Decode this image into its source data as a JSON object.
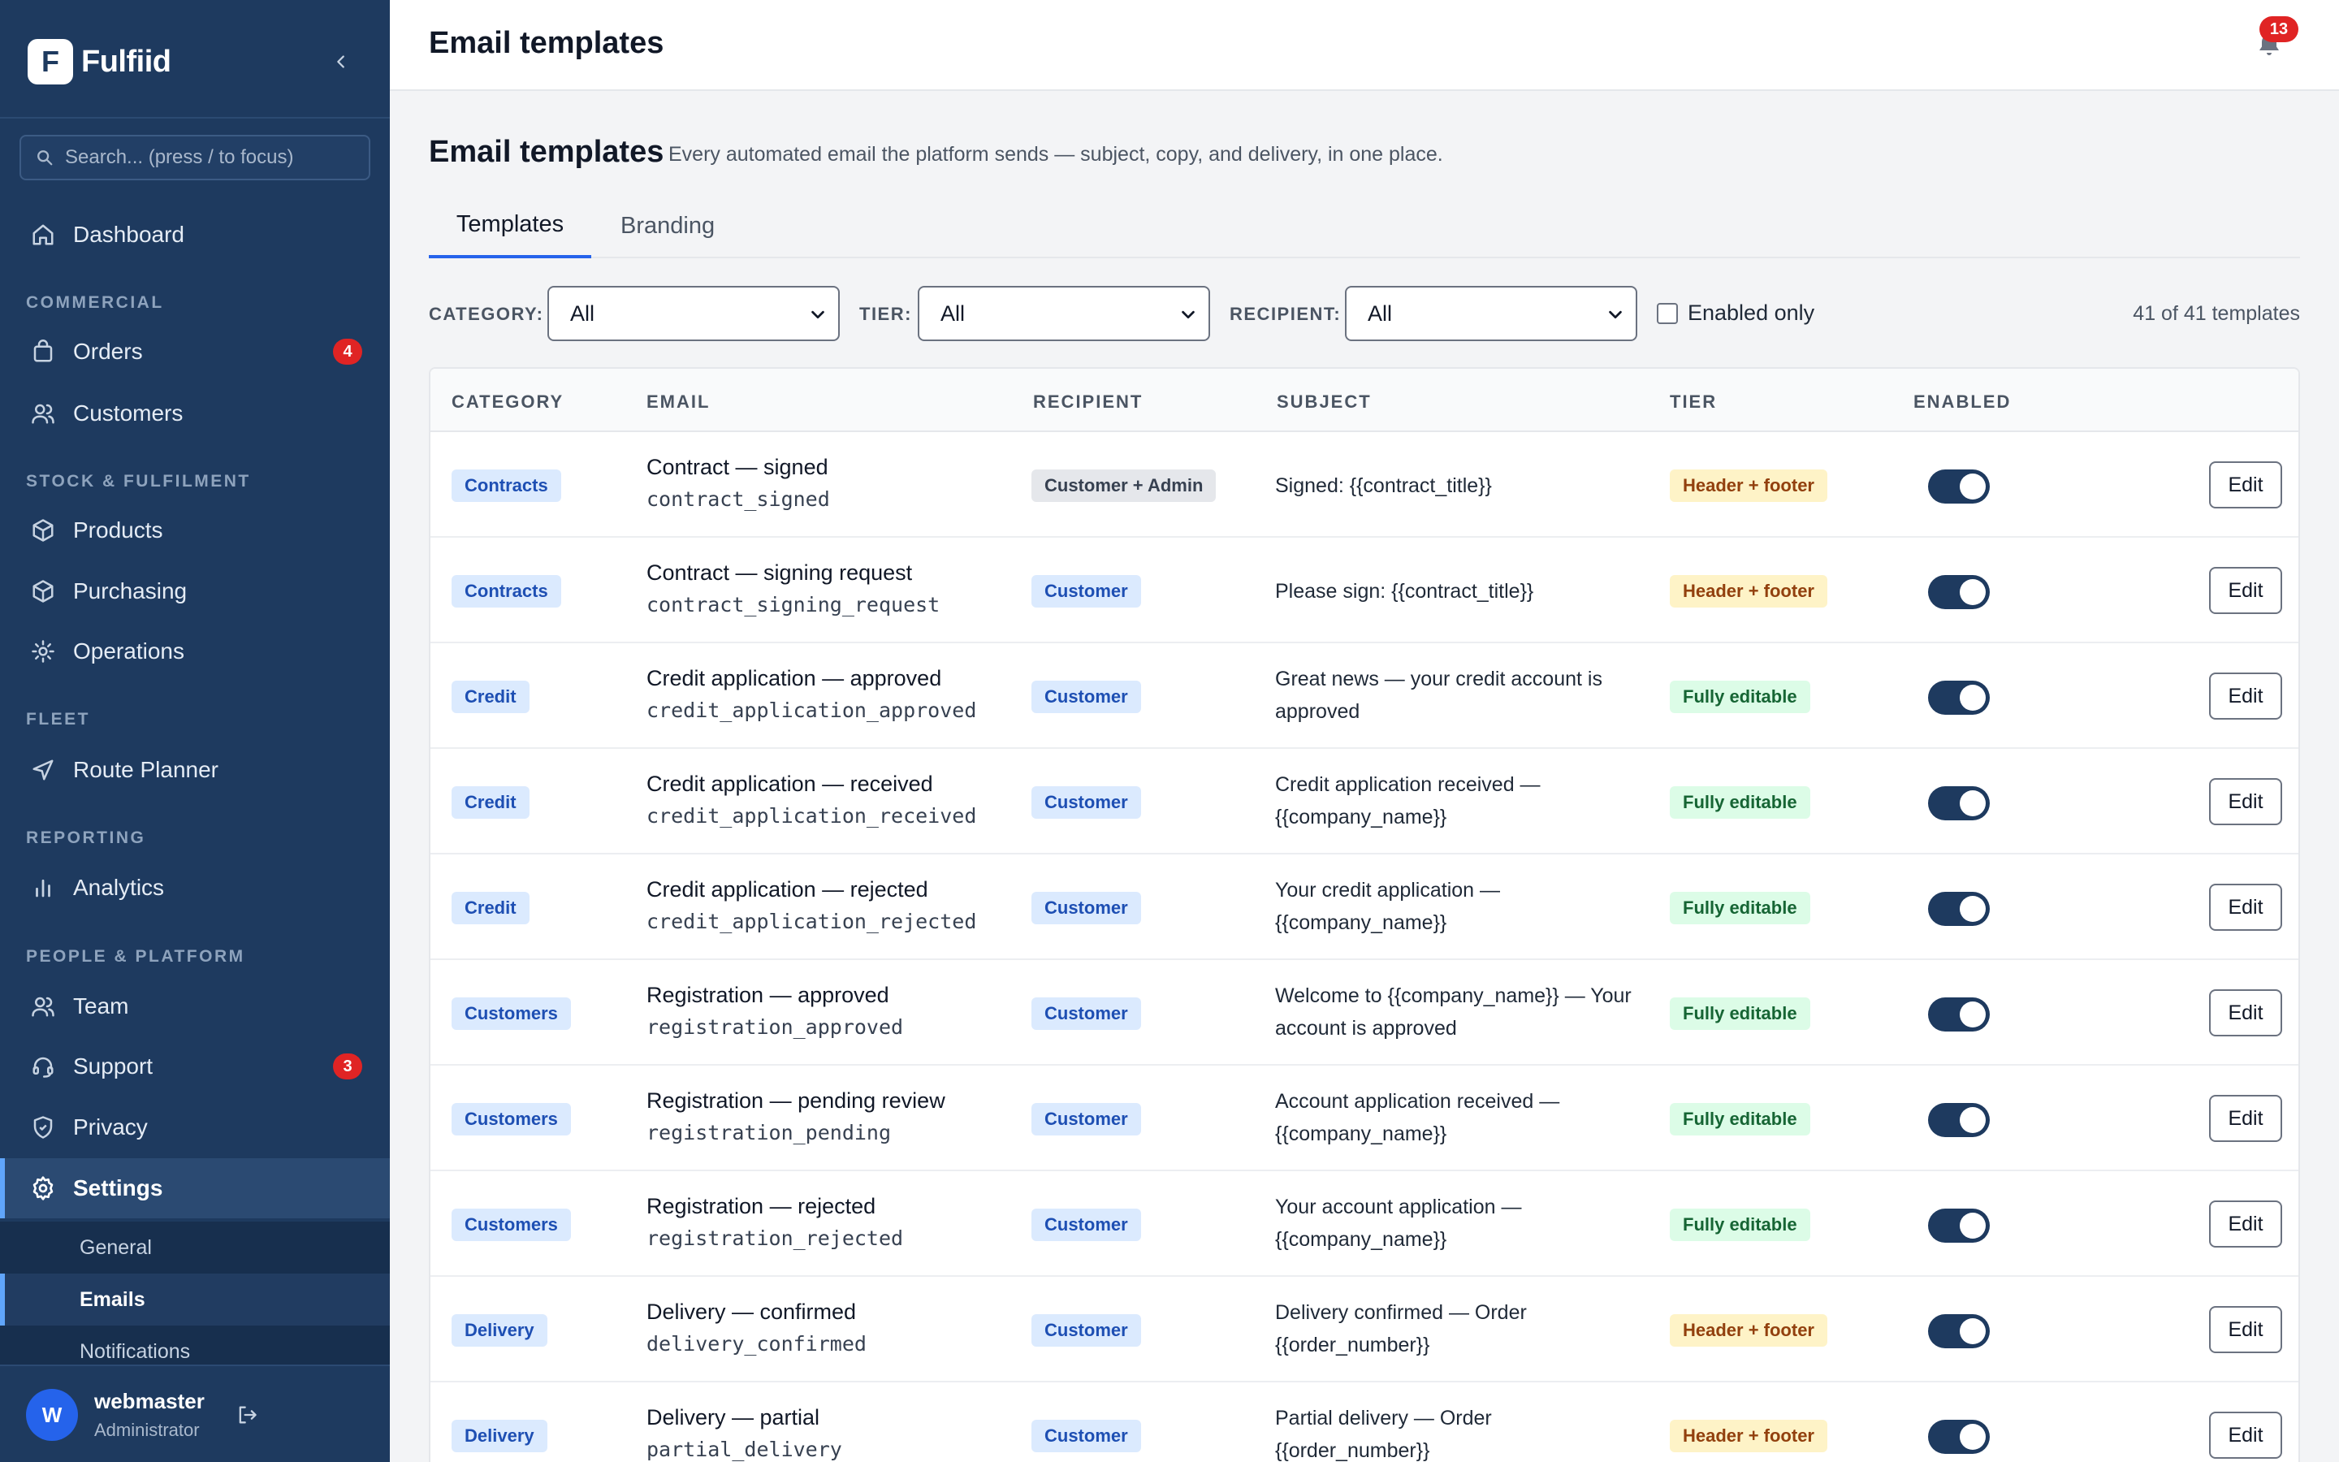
{
  "app": {
    "name": "Fulfiid",
    "logo_letter": "F"
  },
  "sidebar": {
    "search_placeholder": "Search... (press / to focus)",
    "dashboard": "Dashboard",
    "sections": {
      "commercial": "COMMERCIAL",
      "stock": "STOCK & FULFILMENT",
      "fleet": "FLEET",
      "reporting": "REPORTING",
      "people": "PEOPLE & PLATFORM"
    },
    "items": {
      "orders": {
        "label": "Orders",
        "badge": "4"
      },
      "customers": {
        "label": "Customers"
      },
      "products": {
        "label": "Products"
      },
      "purchasing": {
        "label": "Purchasing"
      },
      "operations": {
        "label": "Operations"
      },
      "route_planner": {
        "label": "Route Planner"
      },
      "analytics": {
        "label": "Analytics"
      },
      "team": {
        "label": "Team"
      },
      "support": {
        "label": "Support",
        "badge": "3"
      },
      "privacy": {
        "label": "Privacy"
      },
      "settings": {
        "label": "Settings"
      }
    },
    "settings_sub": {
      "general": "General",
      "emails": "Emails",
      "notifications": "Notifications"
    },
    "user": {
      "initial": "W",
      "name": "webmaster",
      "role": "Administrator"
    }
  },
  "topbar": {
    "title": "Email templates",
    "notification_count": "13"
  },
  "page": {
    "heading": "Email templates",
    "subheading": "Every automated email the platform sends — subject, copy, and delivery, in one place.",
    "tabs": [
      "Templates",
      "Branding"
    ]
  },
  "filters": {
    "category_label": "CATEGORY:",
    "category_value": "All",
    "tier_label": "TIER:",
    "tier_value": "All",
    "recipient_label": "RECIPIENT:",
    "recipient_value": "All",
    "enabled_only_label": "Enabled only",
    "enabled_only_checked": false,
    "count_text": "41 of 41 templates"
  },
  "table": {
    "headers": [
      "CATEGORY",
      "EMAIL",
      "RECIPIENT",
      "SUBJECT",
      "TIER",
      "ENABLED"
    ],
    "edit_label": "Edit",
    "rows": [
      {
        "category": "Contracts",
        "title": "Contract — signed",
        "key": "contract_signed",
        "recipient": "Customer + Admin",
        "subject": "Signed: {{contract_title}}",
        "tier": "Header + footer",
        "enabled": true
      },
      {
        "category": "Contracts",
        "title": "Contract — signing request",
        "key": "contract_signing_request",
        "recipient": "Customer",
        "subject": "Please sign: {{contract_title}}",
        "tier": "Header + footer",
        "enabled": true
      },
      {
        "category": "Credit",
        "title": "Credit application — approved",
        "key": "credit_application_approved",
        "recipient": "Customer",
        "subject": "Great news — your credit account is approved",
        "tier": "Fully editable",
        "enabled": true
      },
      {
        "category": "Credit",
        "title": "Credit application — received",
        "key": "credit_application_received",
        "recipient": "Customer",
        "subject": "Credit application received — {{company_name}}",
        "tier": "Fully editable",
        "enabled": true
      },
      {
        "category": "Credit",
        "title": "Credit application — rejected",
        "key": "credit_application_rejected",
        "recipient": "Customer",
        "subject": "Your credit application — {{company_name}}",
        "tier": "Fully editable",
        "enabled": true
      },
      {
        "category": "Customers",
        "title": "Registration — approved",
        "key": "registration_approved",
        "recipient": "Customer",
        "subject": "Welcome to {{company_name}} — Your account is approved",
        "tier": "Fully editable",
        "enabled": true
      },
      {
        "category": "Customers",
        "title": "Registration — pending review",
        "key": "registration_pending",
        "recipient": "Customer",
        "subject": "Account application received — {{company_name}}",
        "tier": "Fully editable",
        "enabled": true
      },
      {
        "category": "Customers",
        "title": "Registration — rejected",
        "key": "registration_rejected",
        "recipient": "Customer",
        "subject": "Your account application — {{company_name}}",
        "tier": "Fully editable",
        "enabled": true
      },
      {
        "category": "Delivery",
        "title": "Delivery — confirmed",
        "key": "delivery_confirmed",
        "recipient": "Customer",
        "subject": "Delivery confirmed — Order {{order_number}}",
        "tier": "Header + footer",
        "enabled": true
      },
      {
        "category": "Delivery",
        "title": "Delivery — partial",
        "key": "partial_delivery",
        "recipient": "Customer",
        "subject": "Partial delivery — Order {{order_number}}",
        "tier": "Header + footer",
        "enabled": true
      }
    ]
  },
  "colors": {
    "sidebar_bg": "#1e3a5f",
    "accent": "#2563eb",
    "badge_red": "#e02424"
  }
}
